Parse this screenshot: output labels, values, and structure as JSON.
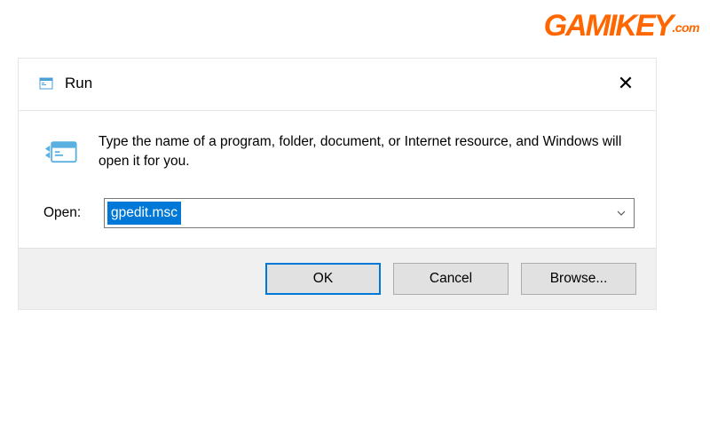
{
  "watermark": {
    "brand_main": "GAMI",
    "brand_key": "KEY",
    "brand_suffix": ".com"
  },
  "dialog": {
    "title": "Run",
    "close_symbol": "✕",
    "description": "Type the name of a program, folder, document, or Internet resource, and Windows will open it for you.",
    "open_label": "Open:",
    "input_value": "gpedit.msc",
    "buttons": {
      "ok": "OK",
      "cancel": "Cancel",
      "browse": "Browse..."
    }
  }
}
